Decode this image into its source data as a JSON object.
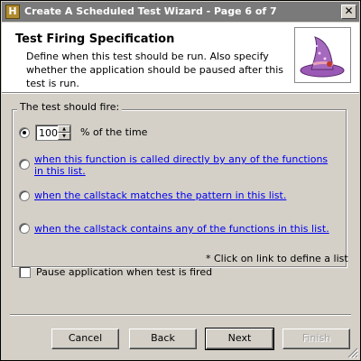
{
  "window": {
    "title": "Create A Scheduled Test Wizard - Page 6 of 7",
    "close_glyph": "✕",
    "app_icon_glyph": "H"
  },
  "header": {
    "title": "Test Firing Specification",
    "subtitle": "Define when this test should be run. Also specify whether the application should be paused after this test is run.",
    "image_icon": "wizard-hat-icon"
  },
  "group": {
    "label": "The test should fire:",
    "options": [
      {
        "type": "percent",
        "value": "100",
        "suffix": "% of the time",
        "checked": true
      },
      {
        "type": "link",
        "label": "when this function is called directly by any of the functions in this list.",
        "checked": false
      },
      {
        "type": "link",
        "label": "when the callstack matches the pattern in this list.",
        "checked": false
      },
      {
        "type": "link",
        "label": "when the callstack contains any of the functions in this list.",
        "checked": false
      }
    ],
    "footnote": "* Click on link to define a list"
  },
  "pause": {
    "label": "Pause application when test is fired",
    "checked": false
  },
  "buttons": {
    "cancel": "Cancel",
    "back": "Back",
    "next": "Next",
    "finish": "Finish"
  },
  "colors": {
    "titlebar": "#7a7a7a",
    "dialog_bg": "#d4d0c8",
    "link": "#0000ee"
  }
}
